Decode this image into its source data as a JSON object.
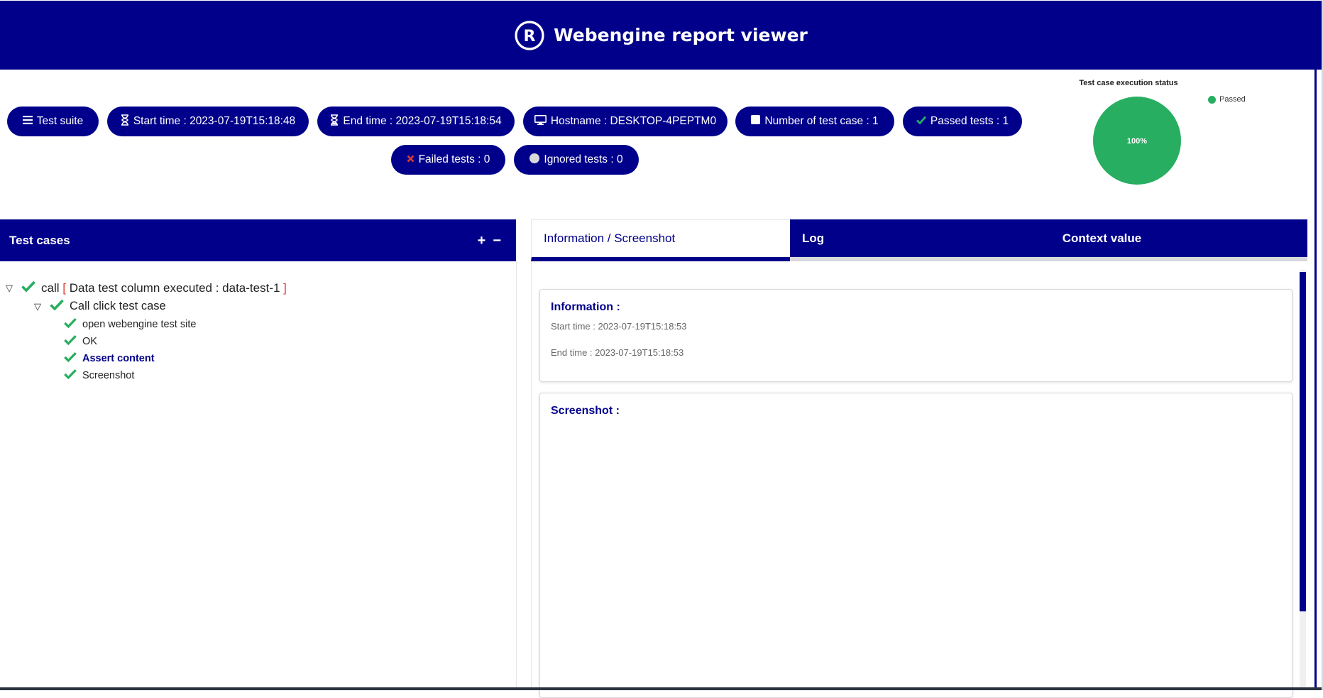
{
  "app": {
    "title": "Webengine report viewer",
    "logo_icon": "registered-icon"
  },
  "stats": {
    "test_suite": "Test suite",
    "start_time": "Start time : 2023-07-19T15:18:48",
    "end_time": "End time : 2023-07-19T15:18:54",
    "hostname": "Hostname : DESKTOP-4PEPTM0",
    "test_case_count": "Number of test case : 1",
    "passed": "Passed tests : 1",
    "failed": "Failed tests : 0",
    "ignored": "Ignored tests : 0"
  },
  "chart_data": {
    "type": "pie",
    "title": "Test case execution status",
    "categories": [
      "Passed"
    ],
    "values": [
      100
    ],
    "labels": [
      "100%"
    ],
    "colors": [
      "#27ae60"
    ],
    "legend_position": "top-right"
  },
  "test_cases_panel": {
    "title": "Test cases",
    "expand_icon": "+",
    "collapse_icon": "−",
    "tree": {
      "root_prefix": "call",
      "root_bracket_open": "[",
      "root_detail": "Data test column executed : data-test-1",
      "root_bracket_close": "]",
      "child": "Call click test case",
      "steps": [
        "open webengine test site",
        "OK",
        "Assert content",
        "Screenshot"
      ],
      "selected_step": "Assert content"
    }
  },
  "tabs": {
    "info": "Information / Screenshot",
    "log": "Log",
    "context": "Context value"
  },
  "information": {
    "title": "Information :",
    "start_time": "Start time : 2023-07-19T15:18:53",
    "end_time": "End time : 2023-07-19T15:18:53"
  },
  "screenshot": {
    "title": "Screenshot :"
  },
  "colors": {
    "primary": "#00008b",
    "passed": "#27ae60",
    "failed": "#e23b2e",
    "ignored": "#d9d9d9"
  }
}
